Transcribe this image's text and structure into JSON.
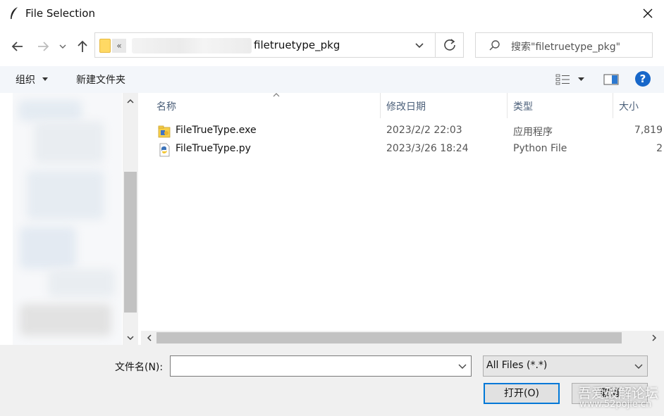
{
  "window": {
    "title": "File Selection"
  },
  "nav": {
    "address_chevron": "«",
    "address_path": "filetruetype_pkg",
    "search_placeholder": "搜索\"filetruetype_pkg\""
  },
  "toolbar": {
    "organize_label": "组织",
    "new_folder_label": "新建文件夹",
    "help_label": "?"
  },
  "columns": {
    "name": "名称",
    "date": "修改日期",
    "type": "类型",
    "size": "大小"
  },
  "files": [
    {
      "name": "FileTrueType.exe",
      "date": "2023/2/2 22:03",
      "type": "应用程序",
      "size": "7,819",
      "icon": "exe-icon"
    },
    {
      "name": "FileTrueType.py",
      "date": "2023/3/26 18:24",
      "type": "Python File",
      "size": "2",
      "icon": "python-file-icon"
    }
  ],
  "bottom": {
    "filename_label": "文件名(N):",
    "filename_value": "",
    "filter_value": "All Files (*.*)",
    "open_label": "打开(O)",
    "cancel_label": "取消"
  },
  "watermark": {
    "text": "吾爱破解论坛",
    "url": "www.52pojie.cn"
  },
  "colors": {
    "accent": "#0078d7",
    "help_icon": "#1767c9",
    "folder": "#ffd964"
  }
}
